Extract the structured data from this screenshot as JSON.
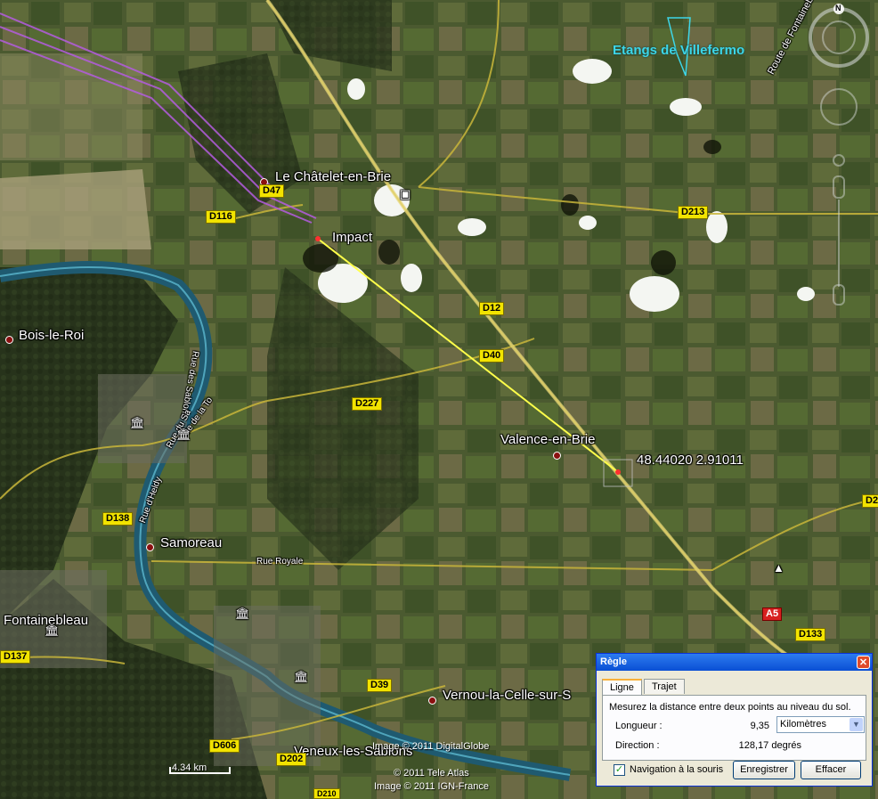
{
  "map": {
    "places": {
      "le_chatelet": "Le Châtelet-en-Brie",
      "impact": "Impact",
      "bois_le_roi": "Bois-le-Roi",
      "valence": "Valence-en-Brie",
      "samoreau": "Samoreau",
      "fontainebleau": "Fontainebleau",
      "vernou": "Vernou-la-Celle-sur-S",
      "veneux": "Veneux-les-Sablons",
      "etangs": "Etangs de Villefermo",
      "coordinates": "48.44020 2.91011"
    },
    "street_labels": {
      "route_fontainebleau": "Route de Fontainebleau",
      "rue_royale": "Rue Royale",
      "rue_sablons": "Rue des Sablons",
      "rue_sa": "Rue du Sa",
      "rue_heldy": "Rue d'Heldy",
      "rue_ty": "Rue de la To"
    },
    "roads": {
      "d47": "D47",
      "d116": "D116",
      "d213": "D213",
      "d12": "D12",
      "d40": "D40",
      "d227": "D227",
      "d138": "D138",
      "d137": "D137",
      "d39": "D39",
      "d606": "D606",
      "d133": "D133",
      "a5": "A5",
      "d2": "D2",
      "d202": "D202",
      "d210": "D210"
    },
    "scale_label": "4.34  km",
    "credits": [
      "Image © 2011 DigitalGlobe",
      "© 2011 Tele Atlas",
      "Image © 2011 IGN-France"
    ],
    "compass_north": "N"
  },
  "ruler": {
    "title": "Règle",
    "close": "✕",
    "tabs": [
      "Ligne",
      "Trajet"
    ],
    "description": "Mesurez la distance entre deux points au niveau du sol.",
    "length_label": "Longueur :",
    "length_value": "9,35",
    "unit": "Kilomètres",
    "direction_label": "Direction :",
    "direction_value": "128,17 degrés",
    "mouse_nav_label": "Navigation à la souris",
    "mouse_nav_checked": true,
    "save_button": "Enregistrer",
    "clear_button": "Effacer"
  }
}
